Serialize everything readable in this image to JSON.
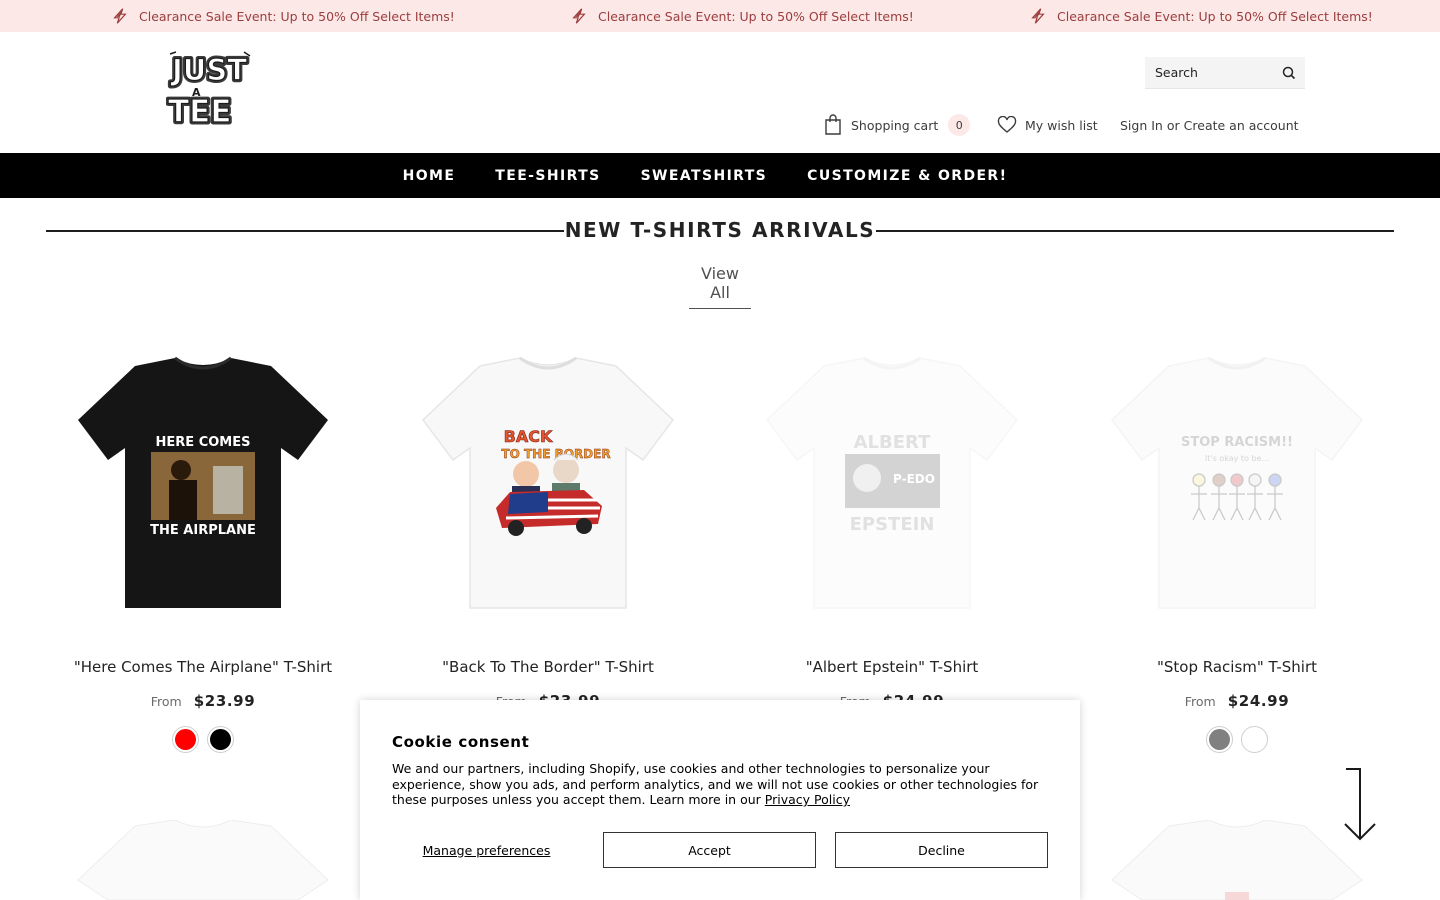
{
  "announcement": {
    "text": "Clearance Sale Event: Up to 50% Off Select Items!",
    "icon": "lightning-bolt-icon",
    "colors": {
      "background": "#fde8e8",
      "text": "#9b3d3d"
    }
  },
  "header": {
    "logo_text": "JUST A TEE",
    "search": {
      "placeholder": "Search",
      "icon": "search-icon"
    },
    "cart": {
      "label": "Shopping cart",
      "count": "0",
      "icon": "shopping-bag-icon"
    },
    "wishlist": {
      "label": "My wish list",
      "icon": "heart-icon"
    },
    "account": {
      "sign_in": "Sign In",
      "or": "or",
      "create": "Create an account"
    }
  },
  "nav": {
    "items": [
      {
        "label": "HOME"
      },
      {
        "label": "TEE-SHIRTS"
      },
      {
        "label": "SWEATSHIRTS"
      },
      {
        "label": "CUSTOMIZE & ORDER!"
      }
    ],
    "colors": {
      "background": "#000000",
      "text": "#ffffff"
    }
  },
  "section": {
    "title": "NEW T-SHIRTS ARRIVALS",
    "view_all": "View All"
  },
  "products": [
    {
      "title": "\"Here Comes The Airplane\" T-Shirt",
      "from": "From",
      "price": "$23.99",
      "shirt_color": "#151515",
      "print_lines": [
        "HERE COMES",
        "THE AIRPLANE"
      ],
      "swatches": [
        "#ff0000",
        "#000000"
      ]
    },
    {
      "title": "\"Back To The Border\" T-Shirt",
      "from": "From",
      "price": "$23.99",
      "shirt_color": "#ffffff",
      "print_lines": [
        "BACK",
        "TO THE BORDER"
      ],
      "swatches": []
    },
    {
      "title": "\"Albert Epstein\" T-Shirt",
      "from": "From",
      "price": "$24.99",
      "shirt_color": "#ffffff",
      "print_lines": [
        "ALBERT",
        "P-EDO",
        "EPSTEIN"
      ],
      "swatches": []
    },
    {
      "title": "\"Stop Racism\" T-Shirt",
      "from": "From",
      "price": "$24.99",
      "shirt_color": "#ffffff",
      "print_lines": [
        "STOP RACISM!!",
        "It's okay to be..."
      ],
      "swatches": [
        "#808080",
        "#ffffff"
      ]
    }
  ],
  "cookie": {
    "title": "Cookie consent",
    "text": "We and our partners, including Shopify, use cookies and other technologies to personalize your experience, show you ads, and perform analytics, and we will not use cookies or other technologies for these purposes unless you accept them. Learn more in our",
    "policy_link": "Privacy Policy",
    "manage": "Manage preferences",
    "accept": "Accept",
    "decline": "Decline"
  },
  "scroll_arrow": {
    "icon": "arrow-down-icon"
  }
}
